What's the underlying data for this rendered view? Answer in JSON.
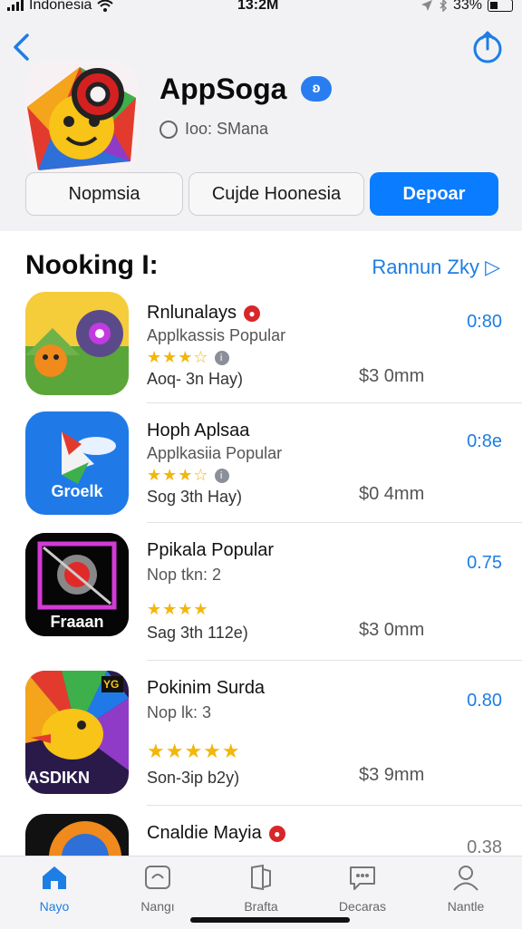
{
  "status_bar": {
    "carrier": "Indonesia",
    "time": "13:2M",
    "battery": "33%"
  },
  "app": {
    "name": "AppSoga",
    "developer": "Ioo: SMana"
  },
  "segments": [
    "Nopmsia",
    "Cujde Hoonesia",
    "Depoar"
  ],
  "section": {
    "title": "Nooking I:",
    "link": "Rannun Zky ▷"
  },
  "list": [
    {
      "name": "Rnlunalays",
      "sub": "Applkassis Popular",
      "stars": "★★★☆",
      "meta": "Aoq- 3n Hay)",
      "price": "$3 0mm",
      "rating": "0:80"
    },
    {
      "name": "Hoph Aplsaa",
      "sub": "Applkasiia Popular",
      "stars": "★★★☆",
      "meta": "Sog 3th Hay)",
      "price": "$0 4mm",
      "rating": "0:8e"
    },
    {
      "name": "Ppikala Popular",
      "sub": "Nop tkn: 2",
      "stars": "★★★★",
      "meta": "Sag 3th 112e)",
      "price": "$3 0mm",
      "rating": "0.75"
    },
    {
      "name": "Pokinim Surda",
      "sub": "Nop lk: 3",
      "stars": "★★★★★",
      "meta": "Son-3ip b2y)",
      "price": "$3 9mm",
      "rating": "0.80"
    },
    {
      "name": "Cnaldie Mayia",
      "sub": "",
      "stars": "",
      "meta": "",
      "price": "",
      "rating": "0.38"
    }
  ],
  "icon_labels": {
    "row2": "Groelk",
    "row3": "Fraaan",
    "row4": "ASDIKN",
    "row4_badge": "YG"
  },
  "tabbar": [
    "Nayo",
    "Nangı",
    "Brafta",
    "Decaras",
    "Nantle"
  ],
  "colors": {
    "accent": "#0a7cff",
    "link": "#1d7ee4",
    "star": "#f3b60a",
    "badge_red": "#d8262a"
  }
}
